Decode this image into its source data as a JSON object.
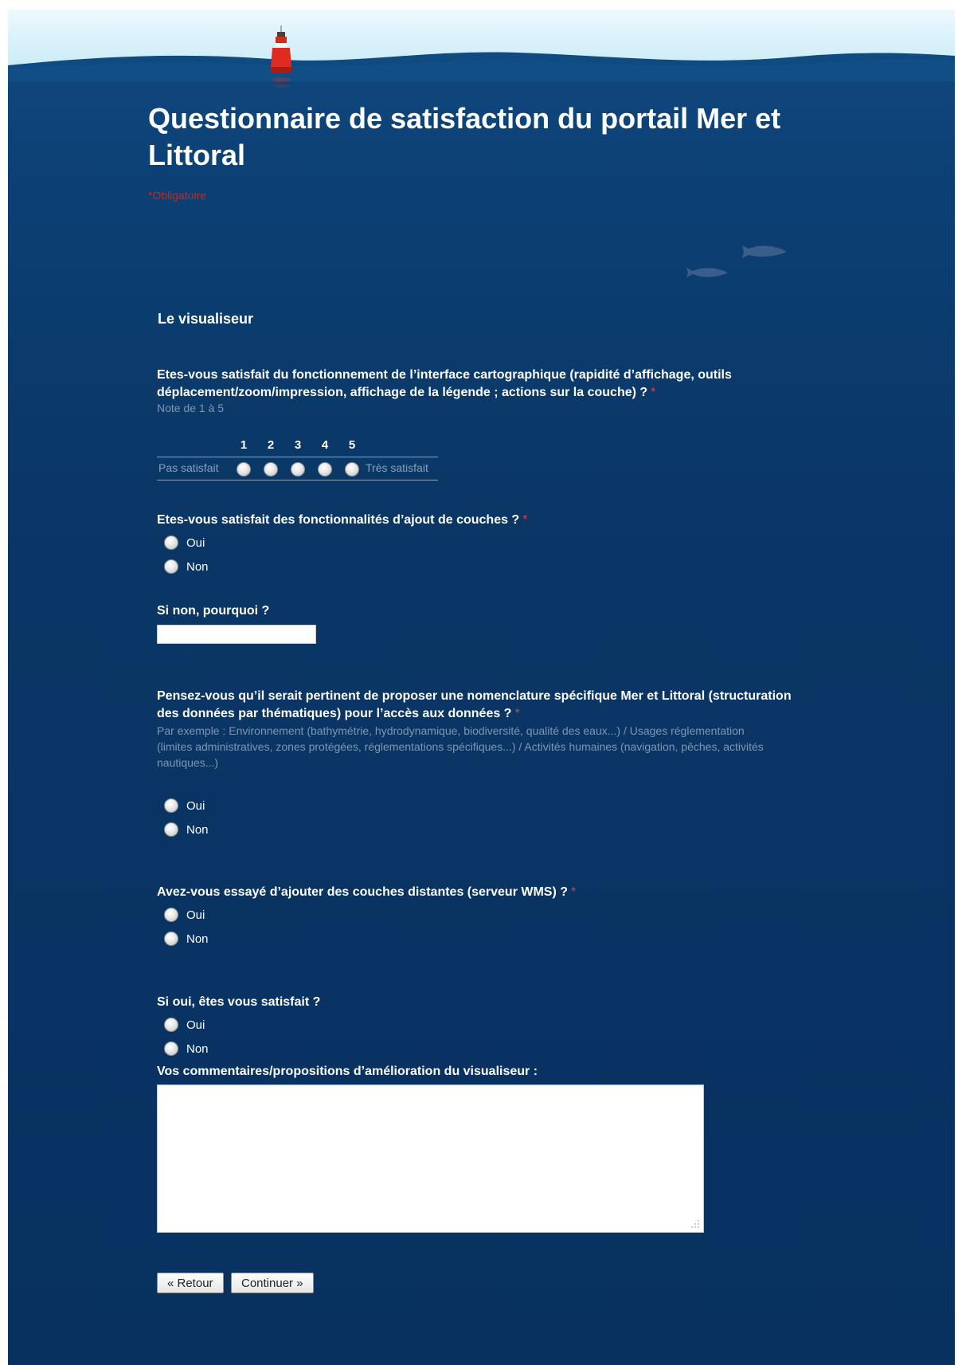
{
  "header": {
    "title": "Questionnaire de satisfaction du portail Mer et Littoral",
    "required_note": "*Obligatoire"
  },
  "section": {
    "title": "Le visualiseur"
  },
  "questions": [
    {
      "label": "Etes-vous satisfait du fonctionnement de l’interface cartographique (rapidité d’affichage, outils déplacement/zoom/impression, affichage de la légende ; actions sur la couche) ?",
      "required": "*",
      "help": "Note de 1 à 5",
      "scale": {
        "values": [
          "1",
          "2",
          "3",
          "4",
          "5"
        ],
        "min_label": "Pas satisfait",
        "max_label": "Très satisfait"
      }
    },
    {
      "label": "Etes-vous satisfait des fonctionnalités d’ajout de couches ?",
      "required": "*",
      "options": [
        "Oui",
        "Non"
      ]
    },
    {
      "label": "Si non, pourquoi ?",
      "input_value": ""
    },
    {
      "label": "Pensez-vous qu’il serait pertinent de proposer une nomenclature spécifique Mer et Littoral (structuration des données par thématiques) pour l’accès aux données ?",
      "required": "*",
      "help": "Par exemple : Environnement (bathymétrie, hydrodynamique, biodiversité, qualité des eaux...) / Usages réglementation (limites administratives, zones protégées, réglementations spécifiques...) / Activités humaines (navigation, pêches, activités nautiques...)",
      "options": [
        "Oui",
        "Non"
      ]
    },
    {
      "label": "Avez-vous essayé d’ajouter des couches distantes (serveur WMS) ?",
      "required": "*",
      "options": [
        "Oui",
        "Non"
      ]
    },
    {
      "label": "Si oui, êtes vous satisfait ?",
      "options": [
        "Oui",
        "Non"
      ]
    },
    {
      "label": "Vos commentaires/propositions d’amélioration du visualiseur :",
      "textarea_value": ""
    }
  ],
  "buttons": {
    "back": "« Retour",
    "continue": "Continuer »"
  },
  "icons": [
    "buoy-icon",
    "fish-icon",
    "resize-grip-icon"
  ],
  "colors": {
    "background": "#0a3766",
    "required": "#d2463a",
    "help_text": "#7f97b0"
  }
}
